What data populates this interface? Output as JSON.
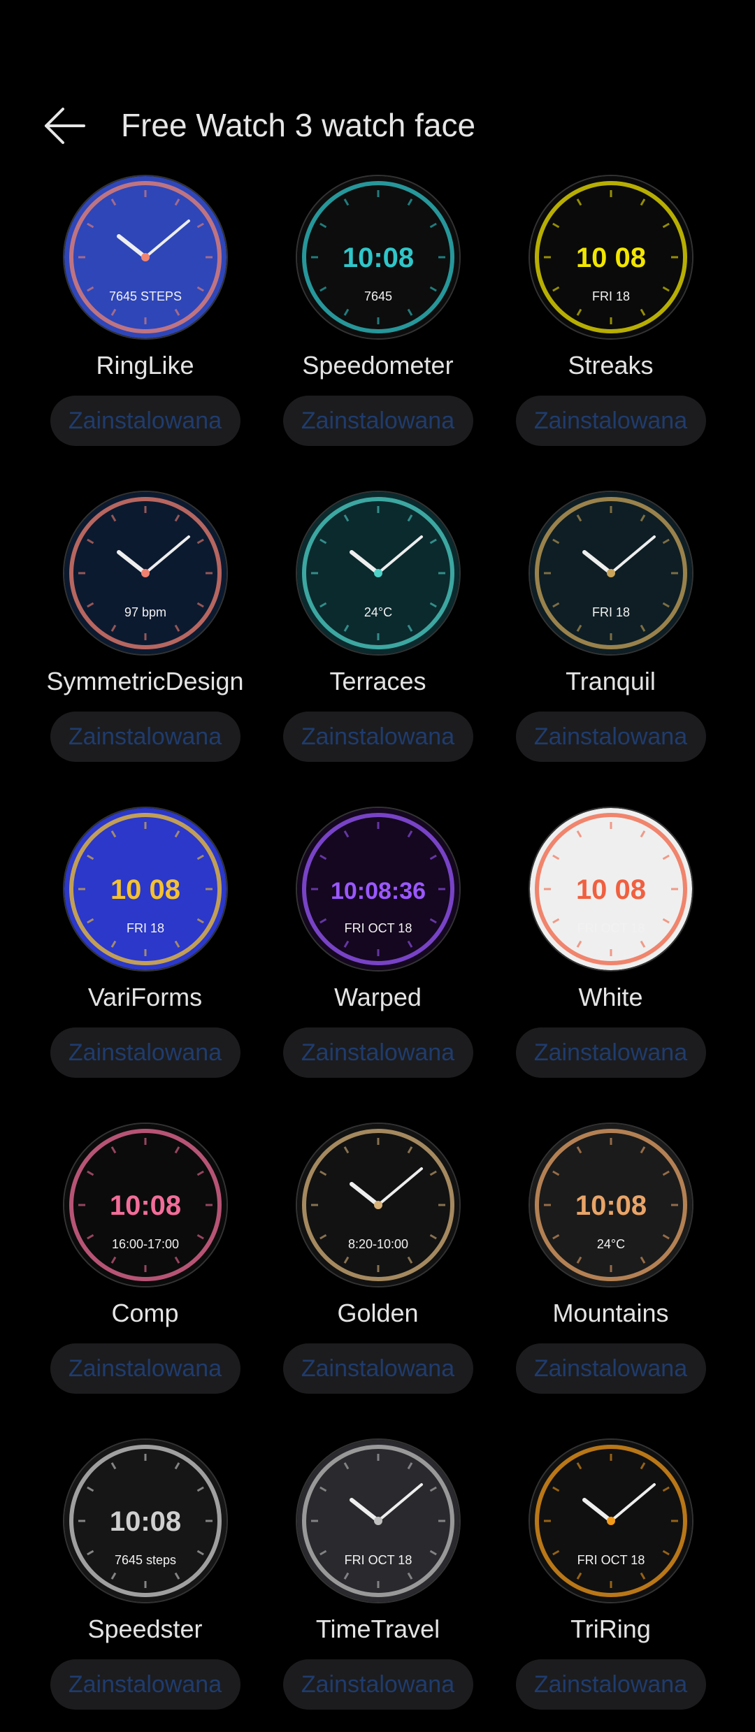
{
  "header": {
    "title": "Free Watch 3 watch face",
    "back_icon": "arrow-left-icon"
  },
  "faces": [
    {
      "name": "RingLike",
      "status": "Zainstalowana",
      "preview": {
        "bg": "#2f46b8",
        "accent": "#f08470",
        "time": "",
        "label": "7645 STEPS"
      }
    },
    {
      "name": "Speedometer",
      "status": "Zainstalowana",
      "preview": {
        "bg": "#0d0d0d",
        "accent": "#2fc6c9",
        "time": "10:08",
        "label": "7645"
      }
    },
    {
      "name": "Streaks",
      "status": "Zainstalowana",
      "preview": {
        "bg": "#0a0a0a",
        "accent": "#f2e600",
        "time": "10 08",
        "label": "FRI 18"
      }
    },
    {
      "name": "SymmetricDesign",
      "status": "Zainstalowana",
      "preview": {
        "bg": "#0c1a30",
        "accent": "#f08070",
        "time": "",
        "label": "97 bpm"
      }
    },
    {
      "name": "Terraces",
      "status": "Zainstalowana",
      "preview": {
        "bg": "#0b2a2e",
        "accent": "#4fd1c8",
        "time": "",
        "label": "24°C"
      }
    },
    {
      "name": "Tranquil",
      "status": "Zainstalowana",
      "preview": {
        "bg": "#0e1e24",
        "accent": "#c9a45a",
        "time": "",
        "label": "FRI 18"
      }
    },
    {
      "name": "VariForms",
      "status": "Zainstalowana",
      "preview": {
        "bg": "#2b38c9",
        "accent": "#f5c230",
        "time": "10 08",
        "label": "FRI 18"
      }
    },
    {
      "name": "Warped",
      "status": "Zainstalowana",
      "preview": {
        "bg": "#15071f",
        "accent": "#9a58ff",
        "time": "10:08:36",
        "label": "FRI OCT 18"
      }
    },
    {
      "name": "White",
      "status": "Zainstalowana",
      "preview": {
        "bg": "#efefef",
        "accent": "#f06040",
        "time": "10 08",
        "label": "FRI OCT 18"
      }
    },
    {
      "name": "Comp",
      "status": "Zainstalowana",
      "preview": {
        "bg": "#0b0b0b",
        "accent": "#f26d9a",
        "time": "10:08",
        "label": "16:00-17:00"
      }
    },
    {
      "name": "Golden",
      "status": "Zainstalowana",
      "preview": {
        "bg": "#121212",
        "accent": "#d7b27a",
        "time": "",
        "label": "8:20-10:00"
      }
    },
    {
      "name": "Mountains",
      "status": "Zainstalowana",
      "preview": {
        "bg": "#1b1b1b",
        "accent": "#e8a468",
        "time": "10:08",
        "label": "24°C"
      }
    },
    {
      "name": "Speedster",
      "status": "Zainstalowana",
      "preview": {
        "bg": "#161616",
        "accent": "#cfcfcf",
        "time": "10:08",
        "label": "7645 steps"
      }
    },
    {
      "name": "TimeTravel",
      "status": "Zainstalowana",
      "preview": {
        "bg": "#2a2a2e",
        "accent": "#bfbfbf",
        "time": "",
        "label": "FRI OCT 18"
      }
    },
    {
      "name": "TriRing",
      "status": "Zainstalowana",
      "preview": {
        "bg": "#101010",
        "accent": "#f29a1a",
        "time": "",
        "label": "FRI OCT 18"
      }
    }
  ]
}
